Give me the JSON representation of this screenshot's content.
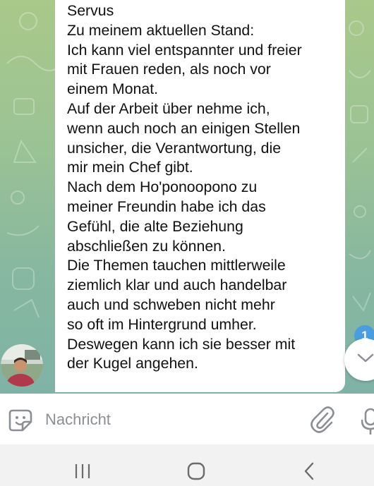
{
  "chat": {
    "message_lines": [
      "Servus",
      "Zu meinem aktuellen Stand:",
      "Ich kann viel entspannter und freier",
      "mit Frauen reden, als noch vor",
      "einem Monat.",
      "Auf der Arbeit über nehme ich,",
      "wenn auch noch an einigen Stellen",
      "unsicher, die Verantwortung, die",
      "mir mein Chef gibt.",
      "Nach dem Ho'ponoopono zu",
      "meiner Freundin habe ich das",
      "Gefühl, die alte Beziehung",
      "abschließen zu können.",
      "Die Themen tauchen mittlerweile",
      "ziemlich klar und auch handelbar",
      "auch und schweben nicht mehr",
      "so oft im Hintergrund umher.",
      "Deswegen kann ich sie besser mit",
      "der Kugel angehen."
    ],
    "unread_count": "1",
    "avatar_icon": "user-avatar-photo",
    "scroll_icon": "chevron-down-icon"
  },
  "composer": {
    "placeholder": "Nachricht",
    "value": "",
    "emoji_icon": "sticker-emoji-icon",
    "attach_icon": "paperclip-icon",
    "mic_icon": "microphone-icon"
  },
  "navigation": {
    "recents_icon": "recent-apps-icon",
    "home_icon": "home-icon",
    "back_icon": "back-icon"
  },
  "colors": {
    "chat_background": "#9cc394",
    "bubble": "#ffffff",
    "badge": "#4a9ee0",
    "icon_gray": "#8b8f94",
    "nav_background": "#f2f2f2"
  }
}
